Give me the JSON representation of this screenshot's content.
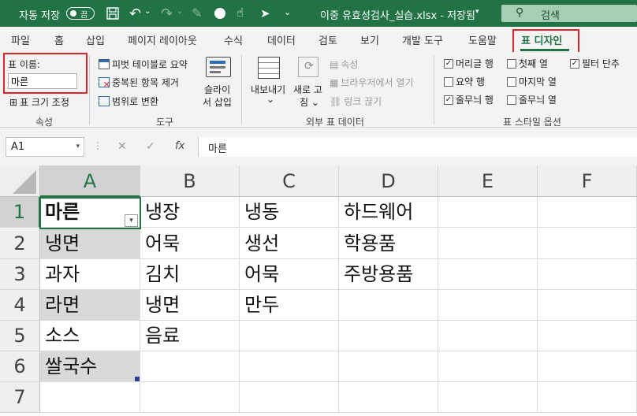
{
  "titlebar": {
    "autosave_label": "자동 저장",
    "autosave_state": "끔",
    "file_title": "이중 유효성검사_실습.xlsx - 저장됨",
    "search_placeholder": "검색"
  },
  "ribbon_tabs": [
    "파일",
    "홈",
    "삽입",
    "페이지 레이아웃",
    "수식",
    "데이터",
    "검토",
    "보기",
    "개발 도구",
    "도움말",
    "표 디자인"
  ],
  "ribbon": {
    "properties": {
      "table_name_label": "표 이름:",
      "table_name_value": "마른",
      "resize_label": "표 크기 조정",
      "group_label": "속성"
    },
    "tools": {
      "pivot_label": "피벗 테이블로 요약",
      "remove_dup_label": "중복된 항목 제거",
      "convert_range_label": "범위로 변환",
      "slicer_line1": "슬라이",
      "slicer_line2": "서 삽입",
      "group_label": "도구"
    },
    "external": {
      "export_line1": "내보내기",
      "export_line2": "⌄",
      "refresh_line1": "새로 고",
      "refresh_line2": "침 ⌄",
      "properties_label": "속성",
      "open_browser_label": "브라우저에서 열기",
      "unlink_label": "링크 끊기",
      "group_label": "외부 표 데이터"
    },
    "style_options": {
      "header_row": "머리글 행",
      "total_row": "요약 행",
      "banded_rows": "줄무늬 행",
      "first_column": "첫째 열",
      "last_column": "마지막 열",
      "banded_columns": "줄무늬 열",
      "filter_button": "필터 단추",
      "checked": {
        "header_row": true,
        "total_row": false,
        "banded_rows": true,
        "first_column": false,
        "last_column": false,
        "banded_columns": false,
        "filter_button": true
      },
      "group_label": "표 스타일 옵션"
    }
  },
  "formula_bar": {
    "name_box": "A1",
    "fx": "fx",
    "content": "마른"
  },
  "sheet": {
    "columns": [
      "A",
      "B",
      "C",
      "D",
      "E",
      "F"
    ],
    "rows": [
      "1",
      "2",
      "3",
      "4",
      "5",
      "6",
      "7"
    ],
    "cells": [
      [
        "마른",
        "냉장",
        "냉동",
        "하드웨어",
        "",
        ""
      ],
      [
        "냉면",
        "어묵",
        "생선",
        "학용품",
        "",
        ""
      ],
      [
        "과자",
        "김치",
        "어묵",
        "주방용품",
        "",
        ""
      ],
      [
        "라면",
        "냉면",
        "만두",
        "",
        "",
        ""
      ],
      [
        "소스",
        "음료",
        "",
        "",
        "",
        ""
      ],
      [
        "쌀국수",
        "",
        "",
        "",
        "",
        ""
      ],
      [
        "",
        "",
        "",
        "",
        "",
        ""
      ]
    ]
  },
  "colors": {
    "excel_green": "#217346",
    "highlight_red": "#e0252a",
    "band_gray": "#d9d9d9"
  }
}
